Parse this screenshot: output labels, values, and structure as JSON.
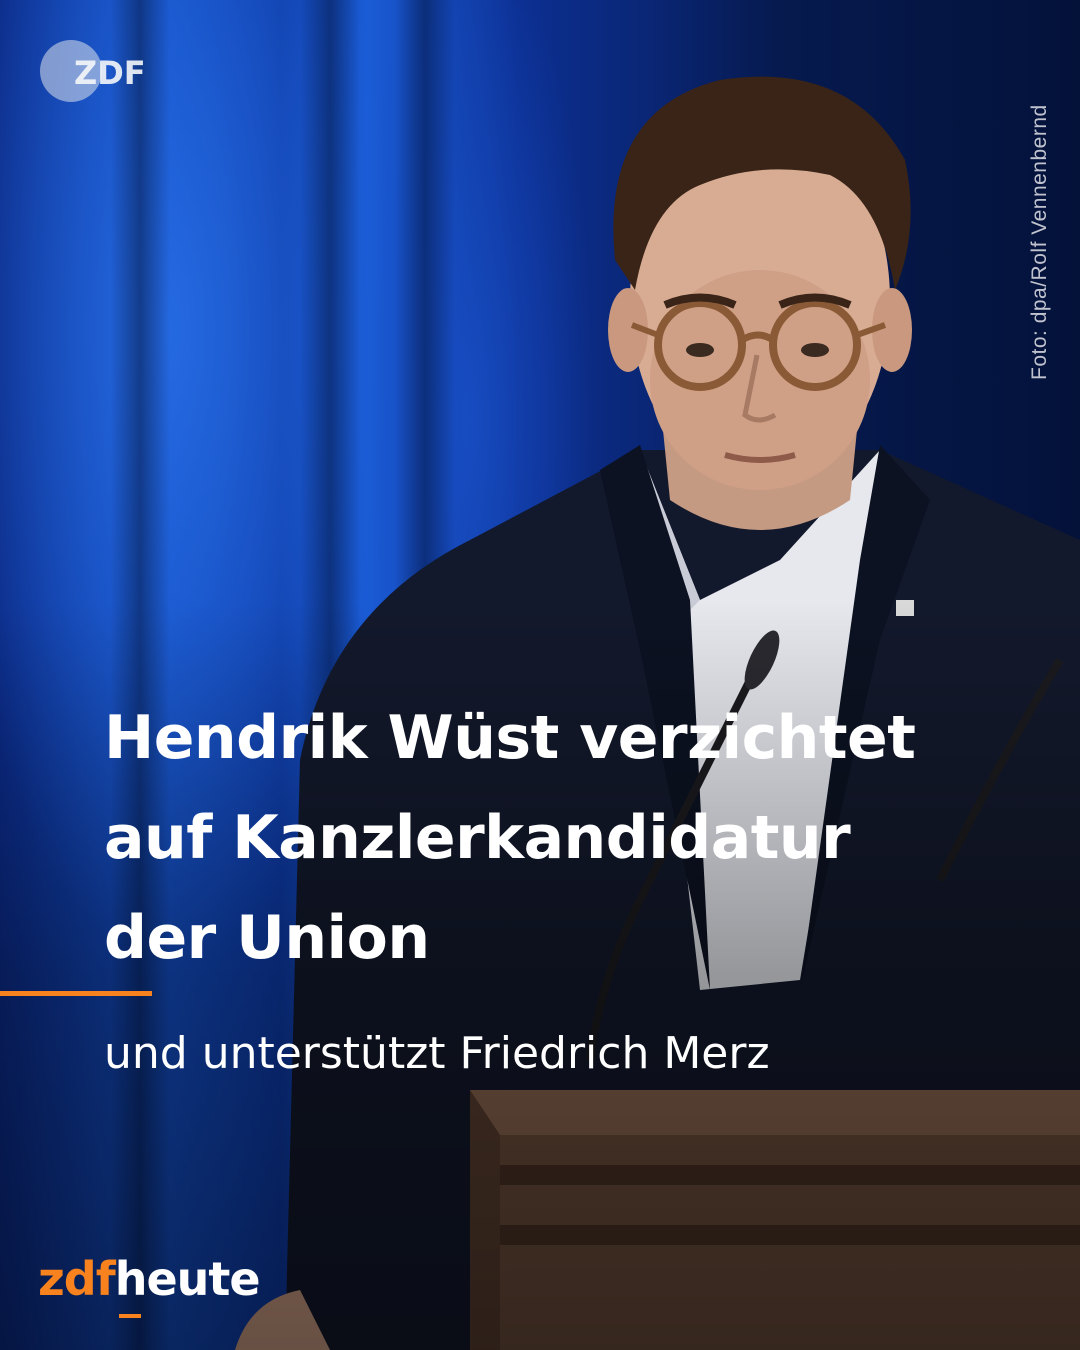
{
  "logo": {
    "label": "ZDF"
  },
  "photo_credit": "Foto: dpa/Rolf Vennenbernd",
  "headline": {
    "lines": [
      "Hendrik Wüst verzichtet",
      "auf Kanzlerkandidatur",
      "der Union"
    ]
  },
  "subline": "und unterstützt Friedrich Merz",
  "brand": {
    "part1": "zdf",
    "part2": "heute"
  },
  "colors": {
    "accent": "#f7821e",
    "text": "#ffffff",
    "background_blue": "#1450c8"
  }
}
